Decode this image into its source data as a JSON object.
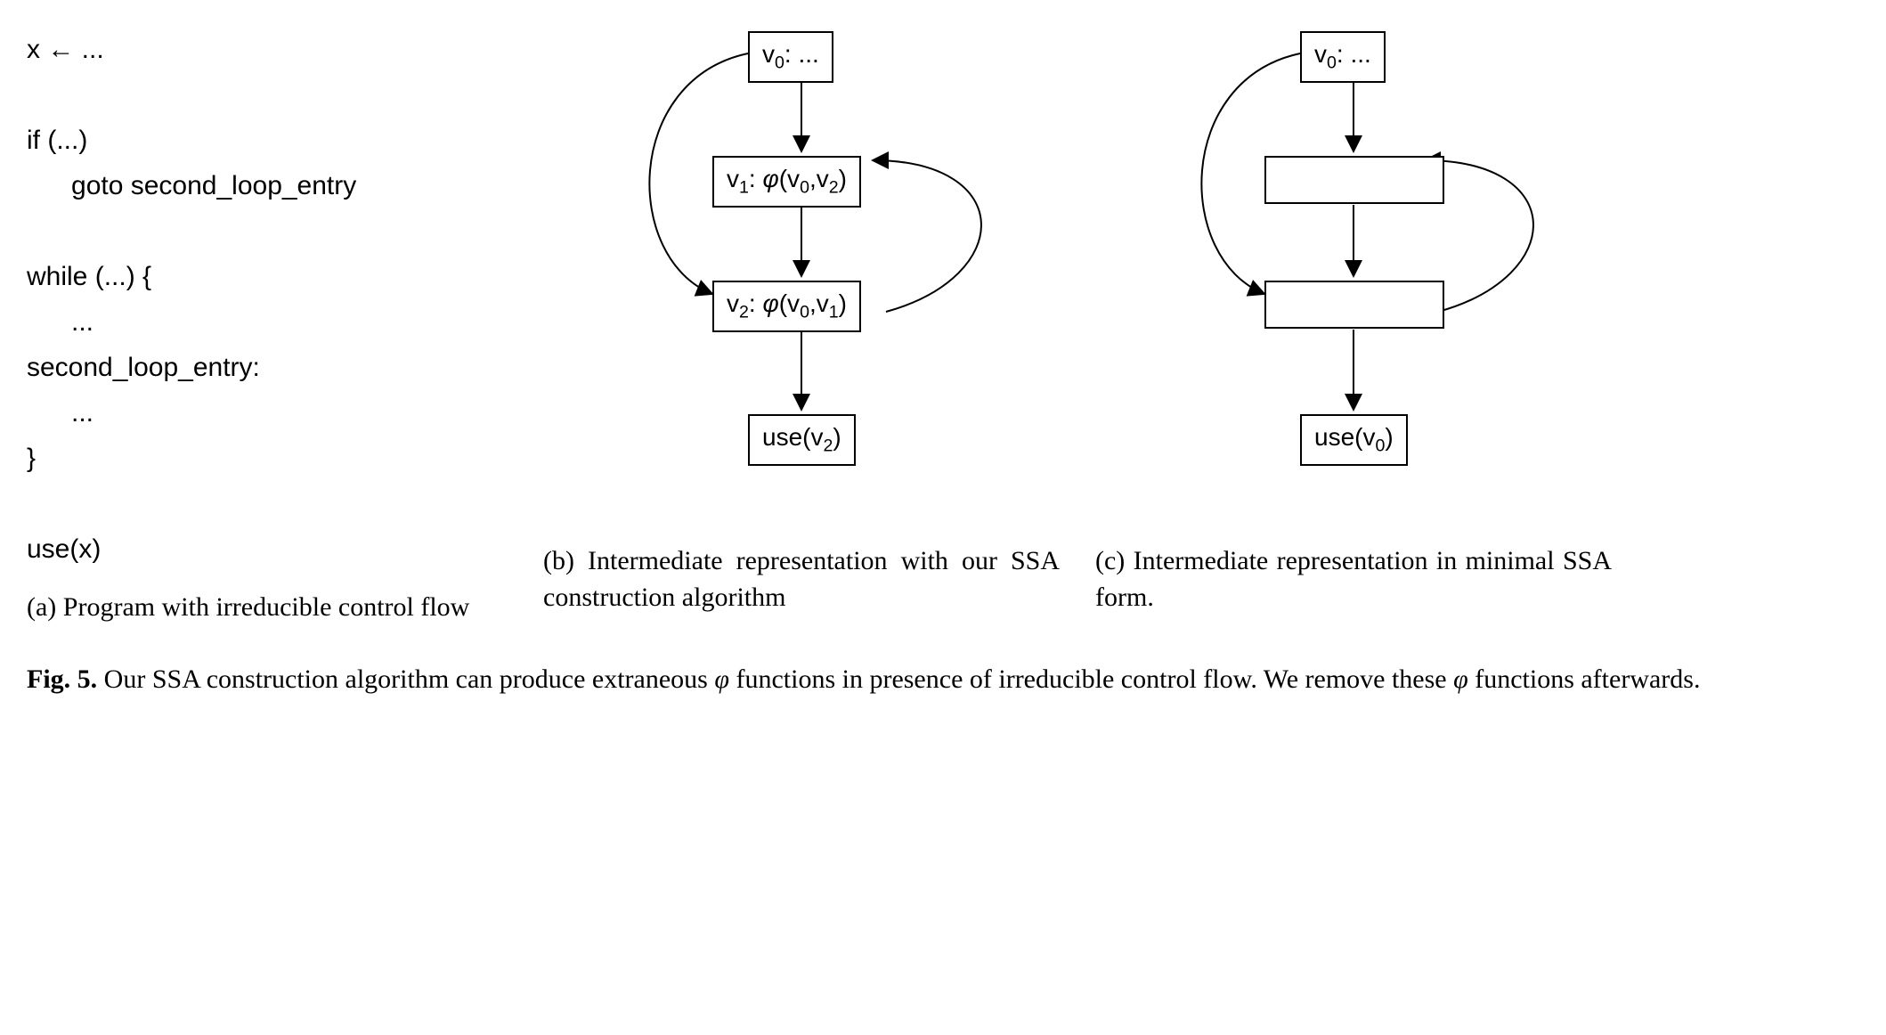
{
  "code": {
    "line1": "x ← ...",
    "line2": "",
    "line3": "if (...)",
    "line4": "      goto second_loop_entry",
    "line5": "",
    "line6": "while (...) {",
    "line7": "      ...",
    "line8": "second_loop_entry:",
    "line9": "      ...",
    "line10": "}",
    "line11": "",
    "line12": "use(x)"
  },
  "diagram_b": {
    "n0_pre": "v",
    "n0_sub": "0",
    "n0_post": ": ...",
    "n1_pre": "v",
    "n1_sub": "1",
    "n1_mid1": ": ",
    "n1_phi": "φ",
    "n1_mid2": "(v",
    "n1_sub2": "0",
    "n1_mid3": ",v",
    "n1_sub3": "2",
    "n1_post": ")",
    "n2_pre": "v",
    "n2_sub": "2",
    "n2_mid1": ": ",
    "n2_phi": "φ",
    "n2_mid2": "(v",
    "n2_sub2": "0",
    "n2_mid3": ",v",
    "n2_sub3": "1",
    "n2_post": ")",
    "n3_pre": "use(v",
    "n3_sub": "2",
    "n3_post": ")"
  },
  "diagram_c": {
    "n0_pre": "v",
    "n0_sub": "0",
    "n0_post": ": ...",
    "n3_pre": "use(v",
    "n3_sub": "0",
    "n3_post": ")"
  },
  "captions": {
    "a": "(a) Program with irreducible control flow",
    "b": "(b) Intermediate representation with our SSA construction algorithm",
    "c": "(c) Intermediate representation in minimal SSA form."
  },
  "main_caption_bold": "Fig. 5.",
  "main_caption_rest_1": " Our SSA construction algorithm can produce extraneous ",
  "main_caption_phi1": "φ",
  "main_caption_rest_2": " functions in presence of irreducible control flow. We remove these ",
  "main_caption_phi2": "φ",
  "main_caption_rest_3": " functions afterwards."
}
